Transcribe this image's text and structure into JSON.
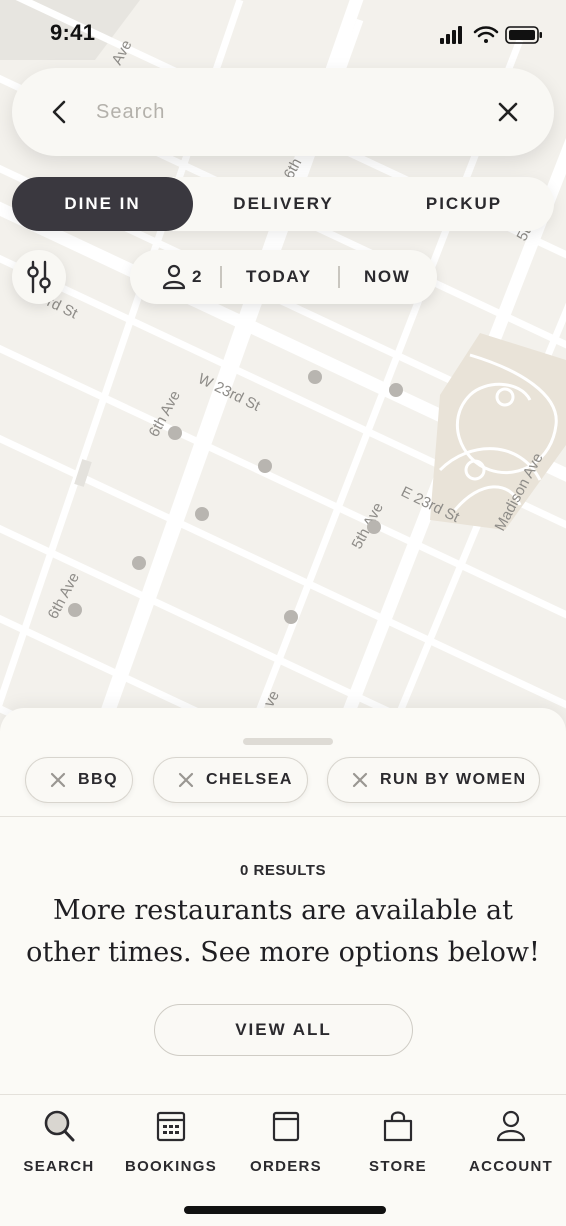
{
  "status_bar": {
    "time": "9:41"
  },
  "search": {
    "placeholder": "Search",
    "value": ""
  },
  "mode_tabs": [
    {
      "label": "DINE IN",
      "active": true
    },
    {
      "label": "DELIVERY",
      "active": false
    },
    {
      "label": "PICKUP",
      "active": false
    }
  ],
  "party": {
    "guests": "2",
    "day": "TODAY",
    "time": "NOW"
  },
  "map": {
    "street_labels": [
      "Ave",
      "6th",
      "rd St",
      "W 23rd St",
      "6th Ave",
      "5th Ave",
      "E 23rd St",
      "Madison Ave",
      "6th Ave",
      "5t",
      "ve"
    ],
    "marker_count": 9
  },
  "filters": [
    {
      "label": "BBQ"
    },
    {
      "label": "CHELSEA"
    },
    {
      "label": "RUN BY WOMEN"
    }
  ],
  "results": {
    "count_label": "0 RESULTS",
    "message_line1": "More restaurants are available at",
    "message_line2": "other times. See more options below!",
    "view_all_label": "VIEW ALL"
  },
  "tab_bar": [
    {
      "label": "SEARCH",
      "icon": "search-icon"
    },
    {
      "label": "BOOKINGS",
      "icon": "calendar-icon"
    },
    {
      "label": "ORDERS",
      "icon": "bag-icon"
    },
    {
      "label": "STORE",
      "icon": "shopping-bag-icon"
    },
    {
      "label": "ACCOUNT",
      "icon": "person-icon"
    }
  ],
  "colors": {
    "accent_dark": "#3a383f",
    "background": "#fbfaf6",
    "map_background": "#f3f1ec",
    "marker": "#b8b5b0"
  }
}
